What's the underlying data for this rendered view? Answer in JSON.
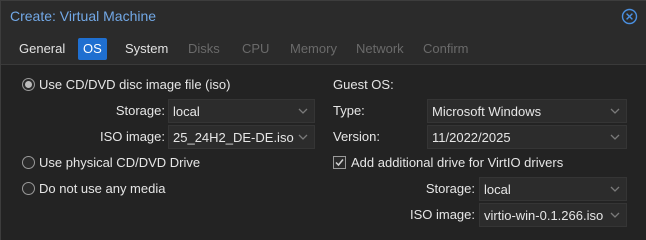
{
  "window": {
    "title": "Create: Virtual Machine"
  },
  "tabs": [
    {
      "label": "General",
      "state": "normal"
    },
    {
      "label": "OS",
      "state": "active"
    },
    {
      "label": "System",
      "state": "normal"
    },
    {
      "label": "Disks",
      "state": "disabled"
    },
    {
      "label": "CPU",
      "state": "disabled"
    },
    {
      "label": "Memory",
      "state": "disabled"
    },
    {
      "label": "Network",
      "state": "disabled"
    },
    {
      "label": "Confirm",
      "state": "disabled"
    }
  ],
  "media": {
    "options": [
      {
        "label": "Use CD/DVD disc image file (iso)",
        "checked": true
      },
      {
        "label": "Use physical CD/DVD Drive",
        "checked": false
      },
      {
        "label": "Do not use any media",
        "checked": false
      }
    ],
    "storage_label": "Storage:",
    "storage_value": "local",
    "iso_label": "ISO image:",
    "iso_value": "25_24H2_DE-DE.iso"
  },
  "guest_os": {
    "heading": "Guest OS:",
    "type_label": "Type:",
    "type_value": "Microsoft Windows",
    "version_label": "Version:",
    "version_value": "11/2022/2025",
    "virtio_checkbox_label": "Add additional drive for VirtIO drivers",
    "virtio_checked": true,
    "storage_label": "Storage:",
    "storage_value": "local",
    "iso_label": "ISO image:",
    "iso_value": "virtio-win-0.1.266.iso"
  },
  "colors": {
    "accent": "#1f6fd0",
    "title_text": "#72a8e6",
    "background": "#242424",
    "disabled_text": "#6a6a6a"
  },
  "icons": {
    "close": "close-circle-icon",
    "dropdown": "chevron-down-icon",
    "check": "check-icon"
  }
}
